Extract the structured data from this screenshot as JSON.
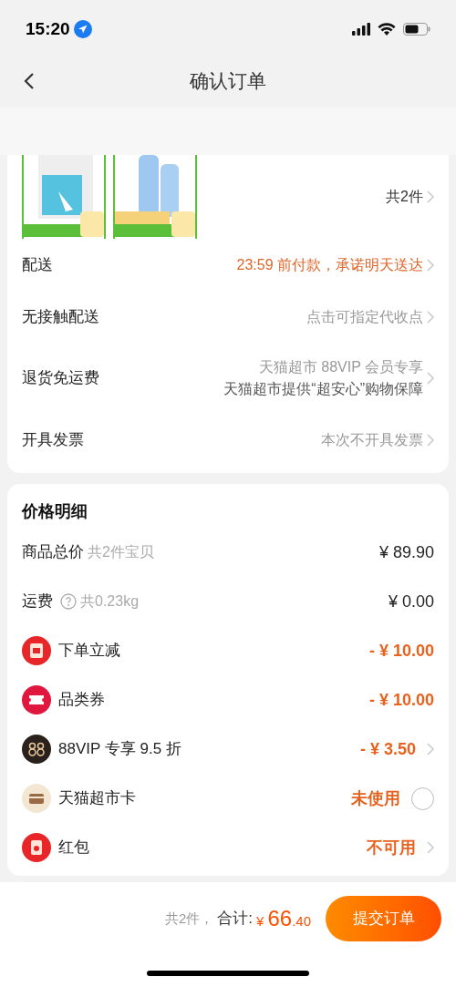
{
  "status_bar": {
    "time": "15:20"
  },
  "nav": {
    "title": "确认订单"
  },
  "order_card": {
    "count": "共2件",
    "rows": [
      {
        "label": "配送",
        "value": [
          "23:59 前付款，承诺明天送达"
        ],
        "highlight": true
      },
      {
        "label": "无接触配送",
        "value": [
          "点击可指定代收点"
        ],
        "highlight": false
      },
      {
        "label": "退货免运费",
        "value": [
          "天猫超市 88VIP 会员专享",
          "天猫超市提供“超安心”购物保障"
        ],
        "highlight": false
      },
      {
        "label": "开具发票",
        "value": [
          "本次不开具发票"
        ],
        "highlight": false
      }
    ]
  },
  "price_card": {
    "title": "价格明细",
    "rows": [
      {
        "kind": "plain",
        "label": "商品总价",
        "note": "共2件宝贝",
        "value": "¥ 89.90",
        "highlight": false,
        "chevron": false
      },
      {
        "kind": "help",
        "label": "运费",
        "note": "共0.23kg",
        "value": "¥ 0.00",
        "highlight": false,
        "chevron": false
      },
      {
        "kind": "reduce",
        "label": "下单立减",
        "value": "- ¥ 10.00",
        "highlight": true,
        "chevron": false
      },
      {
        "kind": "coupon",
        "label": "品类券",
        "value": "- ¥ 10.00",
        "highlight": true,
        "chevron": false
      },
      {
        "kind": "vip",
        "label": "88VIP 专享 9.5 折",
        "value": "- ¥ 3.50",
        "highlight": true,
        "chevron": true
      },
      {
        "kind": "card",
        "label": "天猫超市卡",
        "value": "未使用",
        "highlight": true,
        "chevron": false,
        "checked": false
      },
      {
        "kind": "redpacket",
        "label": "红包",
        "value": "不可用",
        "highlight": true,
        "chevron": true
      }
    ]
  },
  "footer": {
    "count": "共2件，",
    "total_label": "合计:",
    "currency": "¥",
    "total_int": "66",
    "total_dec": ".40",
    "submit": "提交订单"
  }
}
